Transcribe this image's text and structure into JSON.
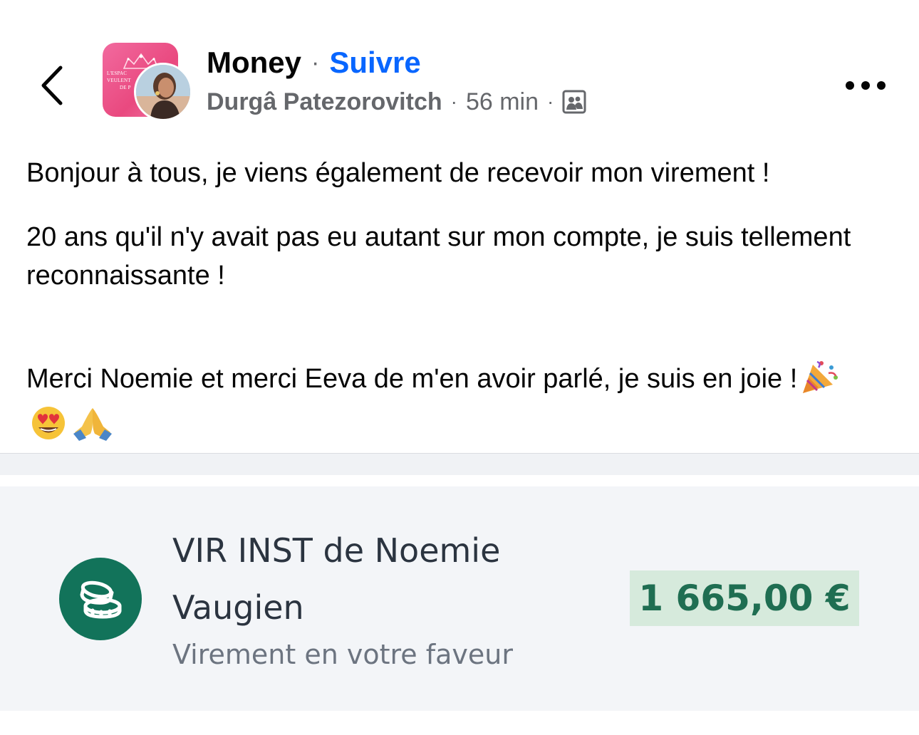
{
  "header": {
    "group_name": "Money",
    "separator": "·",
    "follow_label": "Suivre",
    "author_name": "Durgâ Patezorovitch",
    "time": "56 min",
    "audience_icon": "group-audience-icon",
    "group_logo_text": [
      "L'ESPAC",
      "VEULENT",
      "DE P"
    ]
  },
  "post": {
    "paragraph_1": "Bonjour à tous, je viens également de recevoir mon virement !",
    "paragraph_2": "20 ans qu'il n'y avait pas eu autant sur mon compte, je suis tellement reconnaissante !",
    "paragraph_3": "Merci Noemie et merci Eeva de m'en avoir parlé, je suis en joie !",
    "emojis": [
      "party-popper",
      "heart-eyes",
      "folded-hands"
    ]
  },
  "bank_transaction": {
    "title": "VIR INST de Noemie Vaugien",
    "subtitle": "Virement en votre faveur",
    "amount": "1 665,00 €",
    "icon": "coins-icon"
  },
  "colors": {
    "link_blue": "#0866ff",
    "meta_gray": "#65676b",
    "bank_green": "#12735a",
    "amount_bg": "#d6eadc",
    "amount_text": "#1f6e52",
    "group_pink": "#f26a9f"
  }
}
